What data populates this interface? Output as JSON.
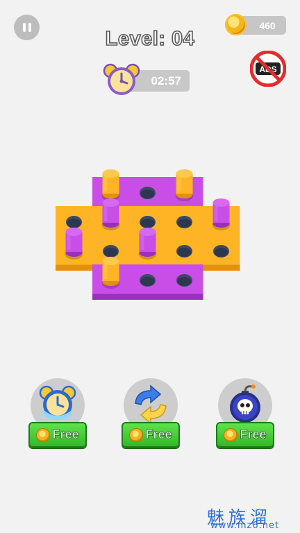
{
  "hud": {
    "level_label": "Level: 04",
    "coins": "460",
    "timer": "02:57",
    "noads_label": "ADS"
  },
  "boosters": [
    {
      "name": "freeze-time",
      "label": "Free"
    },
    {
      "name": "shuffle",
      "label": "Free"
    },
    {
      "name": "bomb",
      "label": "Free"
    }
  ],
  "board": {
    "cells": [
      {
        "row": 0,
        "col": 1,
        "color": "purple",
        "content": "orange-peg"
      },
      {
        "row": 0,
        "col": 2,
        "color": "purple",
        "content": "hole"
      },
      {
        "row": 0,
        "col": 3,
        "color": "purple",
        "content": "orange-peg"
      },
      {
        "row": 1,
        "col": 0,
        "color": "orange",
        "content": "hole"
      },
      {
        "row": 1,
        "col": 1,
        "color": "orange",
        "content": "purple-peg"
      },
      {
        "row": 1,
        "col": 2,
        "color": "orange",
        "content": "hole"
      },
      {
        "row": 1,
        "col": 3,
        "color": "orange",
        "content": "hole"
      },
      {
        "row": 1,
        "col": 4,
        "color": "orange",
        "content": "purple-peg"
      },
      {
        "row": 2,
        "col": 0,
        "color": "orange",
        "content": "purple-peg"
      },
      {
        "row": 2,
        "col": 1,
        "color": "orange",
        "content": "hole"
      },
      {
        "row": 2,
        "col": 2,
        "color": "orange",
        "content": "purple-peg"
      },
      {
        "row": 2,
        "col": 3,
        "color": "orange",
        "content": "hole"
      },
      {
        "row": 2,
        "col": 4,
        "color": "orange",
        "content": "hole"
      },
      {
        "row": 3,
        "col": 1,
        "color": "purple",
        "content": "orange-peg"
      },
      {
        "row": 3,
        "col": 2,
        "color": "purple",
        "content": "hole"
      },
      {
        "row": 3,
        "col": 3,
        "color": "purple",
        "content": "hole"
      }
    ],
    "colors": {
      "orange": "#ffb426",
      "purple": "#c94ee8",
      "hole": "#3c4a63"
    }
  },
  "watermark": {
    "cn": "魅族溜",
    "url": "www.mz6.net"
  }
}
